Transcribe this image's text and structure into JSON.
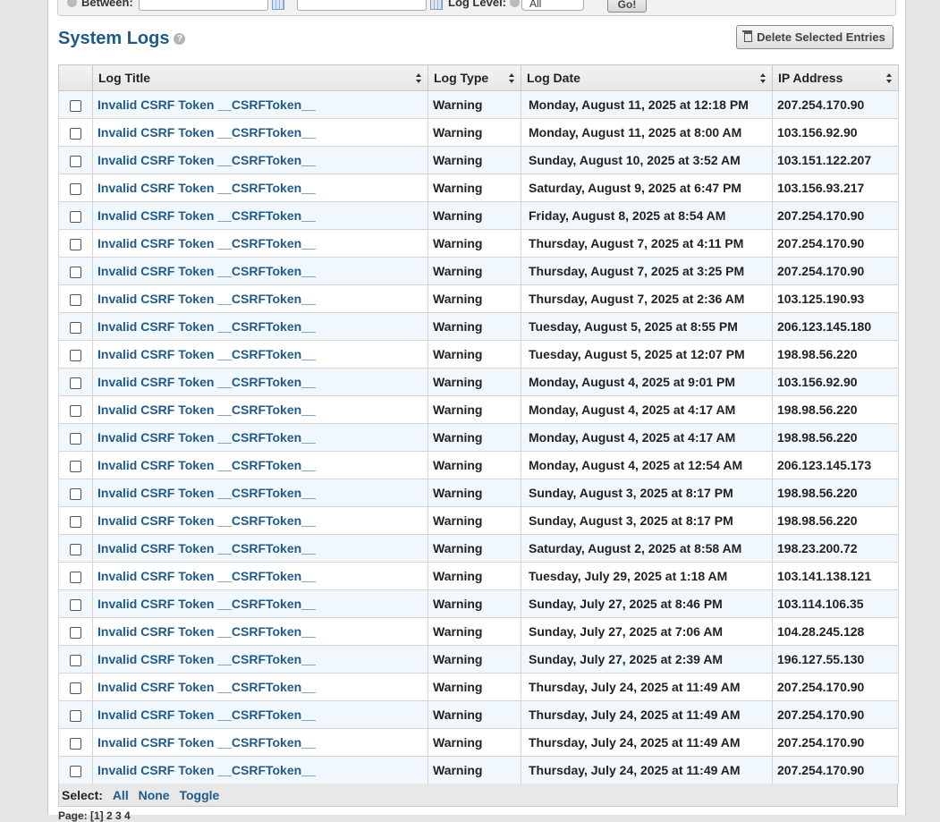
{
  "filter": {
    "between_label": "Between:",
    "log_level_label": "Log Level:",
    "log_level_value": "All",
    "go_label": "Go!"
  },
  "heading": {
    "title": "System Logs",
    "help": "?"
  },
  "delete_label": "Delete Selected Entries",
  "columns": [
    "Log Title",
    "Log Type",
    "Log Date",
    "IP Address"
  ],
  "rows": [
    {
      "title": "Invalid CSRF Token __CSRFToken__",
      "type": "Warning",
      "date": "Monday, August 11, 2025 at 12:18 PM",
      "ip": "207.254.170.90"
    },
    {
      "title": "Invalid CSRF Token __CSRFToken__",
      "type": "Warning",
      "date": "Monday, August 11, 2025 at 8:00 AM",
      "ip": "103.156.92.90"
    },
    {
      "title": "Invalid CSRF Token __CSRFToken__",
      "type": "Warning",
      "date": "Sunday, August 10, 2025 at 3:52 AM",
      "ip": "103.151.122.207"
    },
    {
      "title": "Invalid CSRF Token __CSRFToken__",
      "type": "Warning",
      "date": "Saturday, August 9, 2025 at 6:47 PM",
      "ip": "103.156.93.217"
    },
    {
      "title": "Invalid CSRF Token __CSRFToken__",
      "type": "Warning",
      "date": "Friday, August 8, 2025 at 8:54 AM",
      "ip": "207.254.170.90"
    },
    {
      "title": "Invalid CSRF Token __CSRFToken__",
      "type": "Warning",
      "date": "Thursday, August 7, 2025 at 4:11 PM",
      "ip": "207.254.170.90"
    },
    {
      "title": "Invalid CSRF Token __CSRFToken__",
      "type": "Warning",
      "date": "Thursday, August 7, 2025 at 3:25 PM",
      "ip": "207.254.170.90"
    },
    {
      "title": "Invalid CSRF Token __CSRFToken__",
      "type": "Warning",
      "date": "Thursday, August 7, 2025 at 2:36 AM",
      "ip": "103.125.190.93"
    },
    {
      "title": "Invalid CSRF Token __CSRFToken__",
      "type": "Warning",
      "date": "Tuesday, August 5, 2025 at 8:55 PM",
      "ip": "206.123.145.180"
    },
    {
      "title": "Invalid CSRF Token __CSRFToken__",
      "type": "Warning",
      "date": "Tuesday, August 5, 2025 at 12:07 PM",
      "ip": "198.98.56.220"
    },
    {
      "title": "Invalid CSRF Token __CSRFToken__",
      "type": "Warning",
      "date": "Monday, August 4, 2025 at 9:01 PM",
      "ip": "103.156.92.90"
    },
    {
      "title": "Invalid CSRF Token __CSRFToken__",
      "type": "Warning",
      "date": "Monday, August 4, 2025 at 4:17 AM",
      "ip": "198.98.56.220"
    },
    {
      "title": "Invalid CSRF Token __CSRFToken__",
      "type": "Warning",
      "date": "Monday, August 4, 2025 at 4:17 AM",
      "ip": "198.98.56.220"
    },
    {
      "title": "Invalid CSRF Token __CSRFToken__",
      "type": "Warning",
      "date": "Monday, August 4, 2025 at 12:54 AM",
      "ip": "206.123.145.173"
    },
    {
      "title": "Invalid CSRF Token __CSRFToken__",
      "type": "Warning",
      "date": "Sunday, August 3, 2025 at 8:17 PM",
      "ip": "198.98.56.220"
    },
    {
      "title": "Invalid CSRF Token __CSRFToken__",
      "type": "Warning",
      "date": "Sunday, August 3, 2025 at 8:17 PM",
      "ip": "198.98.56.220"
    },
    {
      "title": "Invalid CSRF Token __CSRFToken__",
      "type": "Warning",
      "date": "Saturday, August 2, 2025 at 8:58 AM",
      "ip": "198.23.200.72"
    },
    {
      "title": "Invalid CSRF Token __CSRFToken__",
      "type": "Warning",
      "date": "Tuesday, July 29, 2025 at 1:18 AM",
      "ip": "103.141.138.121"
    },
    {
      "title": "Invalid CSRF Token __CSRFToken__",
      "type": "Warning",
      "date": "Sunday, July 27, 2025 at 8:46 PM",
      "ip": "103.114.106.35"
    },
    {
      "title": "Invalid CSRF Token __CSRFToken__",
      "type": "Warning",
      "date": "Sunday, July 27, 2025 at 7:06 AM",
      "ip": "104.28.245.128"
    },
    {
      "title": "Invalid CSRF Token __CSRFToken__",
      "type": "Warning",
      "date": "Sunday, July 27, 2025 at 2:39 AM",
      "ip": "196.127.55.130"
    },
    {
      "title": "Invalid CSRF Token __CSRFToken__",
      "type": "Warning",
      "date": "Thursday, July 24, 2025 at 11:49 AM",
      "ip": "207.254.170.90"
    },
    {
      "title": "Invalid CSRF Token __CSRFToken__",
      "type": "Warning",
      "date": "Thursday, July 24, 2025 at 11:49 AM",
      "ip": "207.254.170.90"
    },
    {
      "title": "Invalid CSRF Token __CSRFToken__",
      "type": "Warning",
      "date": "Thursday, July 24, 2025 at 11:49 AM",
      "ip": "207.254.170.90"
    },
    {
      "title": "Invalid CSRF Token __CSRFToken__",
      "type": "Warning",
      "date": "Thursday, July 24, 2025 at 11:49 AM",
      "ip": "207.254.170.90"
    }
  ],
  "select": {
    "label": "Select:",
    "all": "All",
    "none": "None",
    "toggle": "Toggle"
  },
  "pager": "Page: [1] 2 3 4"
}
